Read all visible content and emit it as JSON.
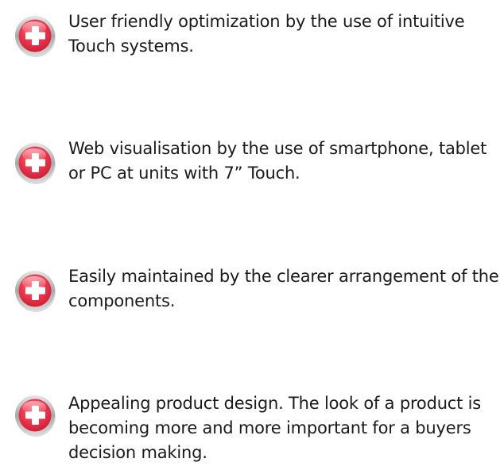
{
  "features": [
    {
      "icon": "plus-badge-icon",
      "text": "User friendly optimization by the use of intuitive Touch systems."
    },
    {
      "icon": "plus-badge-icon",
      "text": "Web visualisation by the use of smartphone, tablet or PC at units with 7” Touch."
    },
    {
      "icon": "plus-badge-icon",
      "text": "Easily maintained by the clearer arrangement of the components."
    },
    {
      "icon": "plus-badge-icon",
      "text": "Appealing product design. The look of a product is becoming more and more important for a buyers decision making."
    }
  ],
  "colors": {
    "badge_red_top": "#f0445a",
    "badge_red_bottom": "#d41f33",
    "badge_ring": "#b9b9b9",
    "text": "#1a1a1a"
  }
}
